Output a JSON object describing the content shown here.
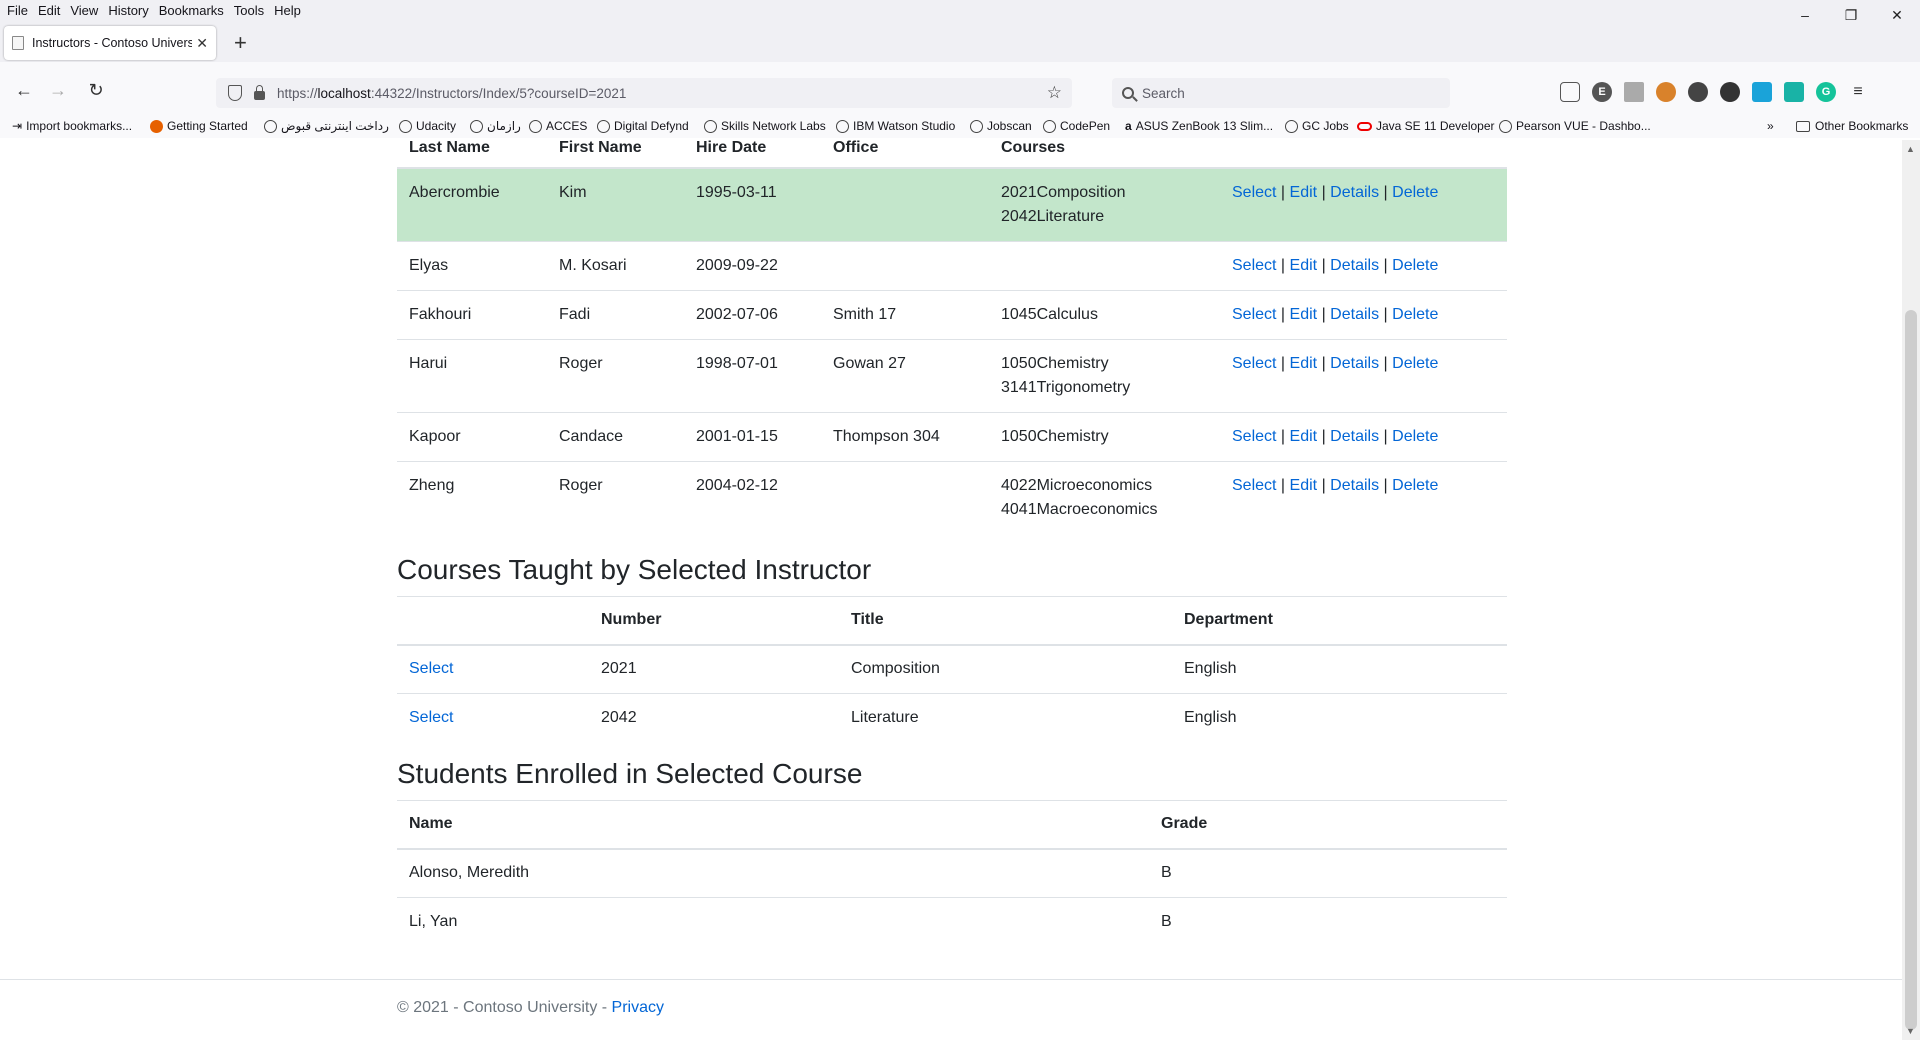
{
  "menubar": {
    "items": [
      "File",
      "Edit",
      "View",
      "History",
      "Bookmarks",
      "Tools",
      "Help"
    ]
  },
  "tab": {
    "title": "Instructors - Contoso University"
  },
  "nav": {
    "url_prefix": "https://",
    "url_host": "localhost",
    "url_rest": ":44322/Instructors/Index/5?courseID=2021",
    "search_placeholder": "Search"
  },
  "bookmarks": {
    "items": [
      "Import bookmarks...",
      "Getting Started",
      "رداخت اینترنتی قبوض",
      "Udacity",
      "رازمان",
      "ACCES",
      "Digital Defynd",
      "Skills Network Labs",
      "IBM Watson Studio",
      "Jobscan",
      "CodePen",
      "ASUS ZenBook 13 Slim...",
      "GC Jobs",
      "Java SE 11 Developer",
      "Pearson VUE - Dashbo..."
    ],
    "other": "Other Bookmarks"
  },
  "instructors": {
    "headers": [
      "Last Name",
      "First Name",
      "Hire Date",
      "Office",
      "Courses",
      ""
    ],
    "actions": [
      "Select",
      "Edit",
      "Details",
      "Delete"
    ],
    "rows": [
      {
        "last": "Abercrombie",
        "first": "Kim",
        "hire": "1995-03-11",
        "office": "",
        "courses": [
          "2021Composition",
          "2042Literature"
        ],
        "selected": true
      },
      {
        "last": "Elyas",
        "first": "M. Kosari",
        "hire": "2009-09-22",
        "office": "",
        "courses": [],
        "selected": false
      },
      {
        "last": "Fakhouri",
        "first": "Fadi",
        "hire": "2002-07-06",
        "office": "Smith 17",
        "courses": [
          "1045Calculus"
        ],
        "selected": false
      },
      {
        "last": "Harui",
        "first": "Roger",
        "hire": "1998-07-01",
        "office": "Gowan 27",
        "courses": [
          "1050Chemistry",
          "3141Trigonometry"
        ],
        "selected": false
      },
      {
        "last": "Kapoor",
        "first": "Candace",
        "hire": "2001-01-15",
        "office": "Thompson 304",
        "courses": [
          "1050Chemistry"
        ],
        "selected": false
      },
      {
        "last": "Zheng",
        "first": "Roger",
        "hire": "2004-02-12",
        "office": "",
        "courses": [
          "4022Microeconomics",
          "4041Macroeconomics"
        ],
        "selected": false
      }
    ]
  },
  "courses": {
    "heading": "Courses Taught by Selected Instructor",
    "headers": [
      "",
      "Number",
      "Title",
      "Department"
    ],
    "rows": [
      {
        "action": "Select",
        "number": "2021",
        "title": "Composition",
        "department": "English"
      },
      {
        "action": "Select",
        "number": "2042",
        "title": "Literature",
        "department": "English"
      }
    ]
  },
  "students": {
    "heading": "Students Enrolled in Selected Course",
    "headers": [
      "Name",
      "Grade"
    ],
    "rows": [
      {
        "name": "Alonso, Meredith",
        "grade": "B"
      },
      {
        "name": "Li, Yan",
        "grade": "B"
      }
    ]
  },
  "footer": {
    "text": "© 2021 - Contoso University - ",
    "link": "Privacy"
  }
}
